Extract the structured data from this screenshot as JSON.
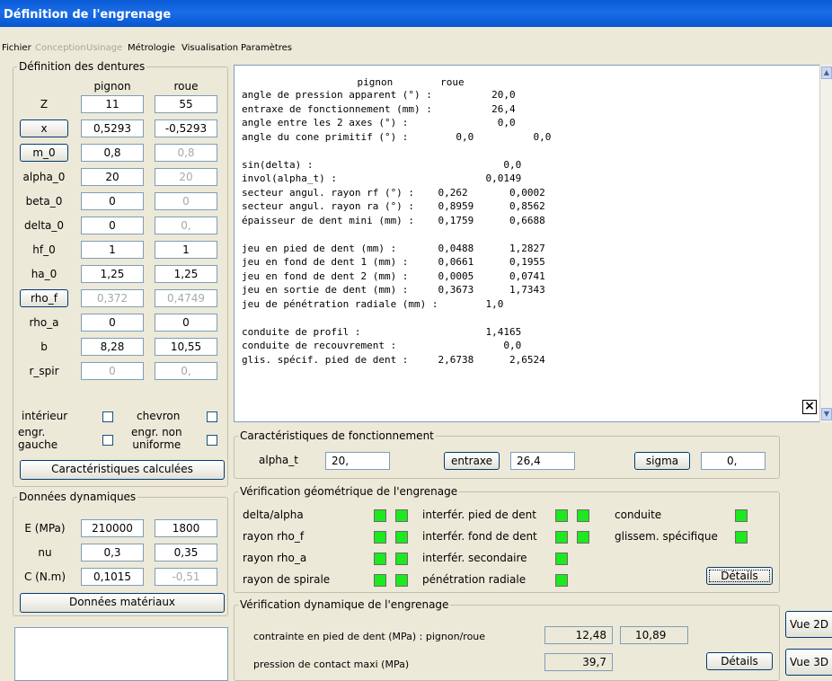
{
  "window": {
    "title": "Définition de l'engrenage"
  },
  "menu": {
    "items": [
      {
        "label": "Fichier",
        "enabled": true
      },
      {
        "label": "Conception",
        "enabled": false
      },
      {
        "label": "Usinage",
        "enabled": false
      },
      {
        "label": "Métrologie",
        "enabled": true
      },
      {
        "label": "Visualisation",
        "enabled": true
      },
      {
        "label": "Paramètres",
        "enabled": true
      }
    ]
  },
  "dentures": {
    "legend": "Définition des dentures",
    "col_pignon": "pignon",
    "col_roue": "roue",
    "rows": [
      {
        "label": "Z",
        "pignon": "11",
        "roue": "55",
        "button": false,
        "pg": false,
        "rg": false
      },
      {
        "label": "x",
        "pignon": "0,5293",
        "roue": "-0,5293",
        "button": true,
        "pg": false,
        "rg": false
      },
      {
        "label": "m_0",
        "pignon": "0,8",
        "roue": "0,8",
        "button": true,
        "pg": false,
        "rg": true
      },
      {
        "label": "alpha_0",
        "pignon": "20",
        "roue": "20",
        "button": false,
        "pg": false,
        "rg": true
      },
      {
        "label": "beta_0",
        "pignon": "0",
        "roue": "0",
        "button": false,
        "pg": false,
        "rg": true
      },
      {
        "label": "delta_0",
        "pignon": "0",
        "roue": "0,",
        "button": false,
        "pg": false,
        "rg": true
      },
      {
        "label": "hf_0",
        "pignon": "1",
        "roue": "1",
        "button": false,
        "pg": false,
        "rg": false
      },
      {
        "label": "ha_0",
        "pignon": "1,25",
        "roue": "1,25",
        "button": false,
        "pg": false,
        "rg": false
      },
      {
        "label": "rho_f",
        "pignon": "0,372",
        "roue": "0,4749",
        "button": true,
        "pg": true,
        "rg": true
      },
      {
        "label": "rho_a",
        "pignon": "0",
        "roue": "0",
        "button": false,
        "pg": false,
        "rg": false
      },
      {
        "label": "b",
        "pignon": "8,28",
        "roue": "10,55",
        "button": false,
        "pg": false,
        "rg": false
      },
      {
        "label": "r_spir",
        "pignon": "0",
        "roue": "0,",
        "button": false,
        "pg": true,
        "rg": true
      }
    ],
    "interieur": "intérieur",
    "chevron": "chevron",
    "engr_gauche": "engr.\ngauche",
    "engr_non_uniforme": "engr. non\nuniforme",
    "btn_calc": "Caractéristiques calculées"
  },
  "dynamiques": {
    "legend": "Données dynamiques",
    "rows": [
      {
        "label": "E (MPa)",
        "pignon": "210000",
        "roue": "1800",
        "rg": false
      },
      {
        "label": "nu",
        "pignon": "0,3",
        "roue": "0,35",
        "rg": false
      },
      {
        "label": "C (N.m)",
        "pignon": "0,1015",
        "roue": "-0,51",
        "rg": true
      }
    ],
    "btn_materiaux": "Données matériaux"
  },
  "results": {
    "header": "                    pignon        roue",
    "lines": [
      "angle de pression apparent (°) :          20,0",
      "entraxe de fonctionnement (mm) :          26,4",
      "angle entre les 2 axes (°) :               0,0",
      "angle du cone primitif (°) :        0,0          0,0",
      "",
      "sin(delta) :                                0,0",
      "invol(alpha_t) :                         0,0149",
      "secteur angul. rayon rf (°) :    0,262       0,0002",
      "secteur angul. rayon ra (°) :    0,8959      0,8562",
      "épaisseur de dent mini (mm) :    0,1759      0,6688",
      "",
      "jeu en pied de dent (mm) :       0,0488      1,2827",
      "jeu en fond de dent 1 (mm) :     0,0661      0,1955",
      "jeu en fond de dent 2 (mm) :     0,0005      0,0741",
      "jeu en sortie de dent (mm) :     0,3673      1,7343",
      "jeu de pénétration radiale (mm) :        1,0",
      "",
      "conduite de profil :                     1,4165",
      "conduite de recouvrement :                  0,0",
      "glis. spécif. pied de dent :     2,6738      2,6524"
    ],
    "close": "×"
  },
  "fonctionnement": {
    "legend": "Caractéristiques de fonctionnement",
    "alpha_label": "alpha_t",
    "alpha_value": "20,",
    "entraxe_btn": "entraxe",
    "entraxe_value": "26,4",
    "sigma_btn": "sigma",
    "sigma_value": "0,"
  },
  "geometrie": {
    "legend": "Vérification géométrique de l'engrenage",
    "c1": [
      "delta/alpha",
      "rayon rho_f",
      "rayon rho_a",
      "rayon de spirale"
    ],
    "c2": [
      "interfér. pied de dent",
      "interfér. fond de dent",
      "interfér. secondaire",
      "pénétration radiale"
    ],
    "c3": [
      "conduite",
      "glissem. spécifique"
    ],
    "details": "Détails"
  },
  "dynamique": {
    "legend": "Vérification dynamique de l'engrenage",
    "contrainte_label": "contrainte en pied de dent (MPa) : pignon/roue",
    "contrainte_p": "12,48",
    "contrainte_r": "10,89",
    "pression_label": "pression de contact maxi (MPa)",
    "pression_value": "39,7",
    "details": "Détails"
  },
  "side": {
    "vue2d": "Vue 2D",
    "vue3d": "Vue 3D"
  }
}
